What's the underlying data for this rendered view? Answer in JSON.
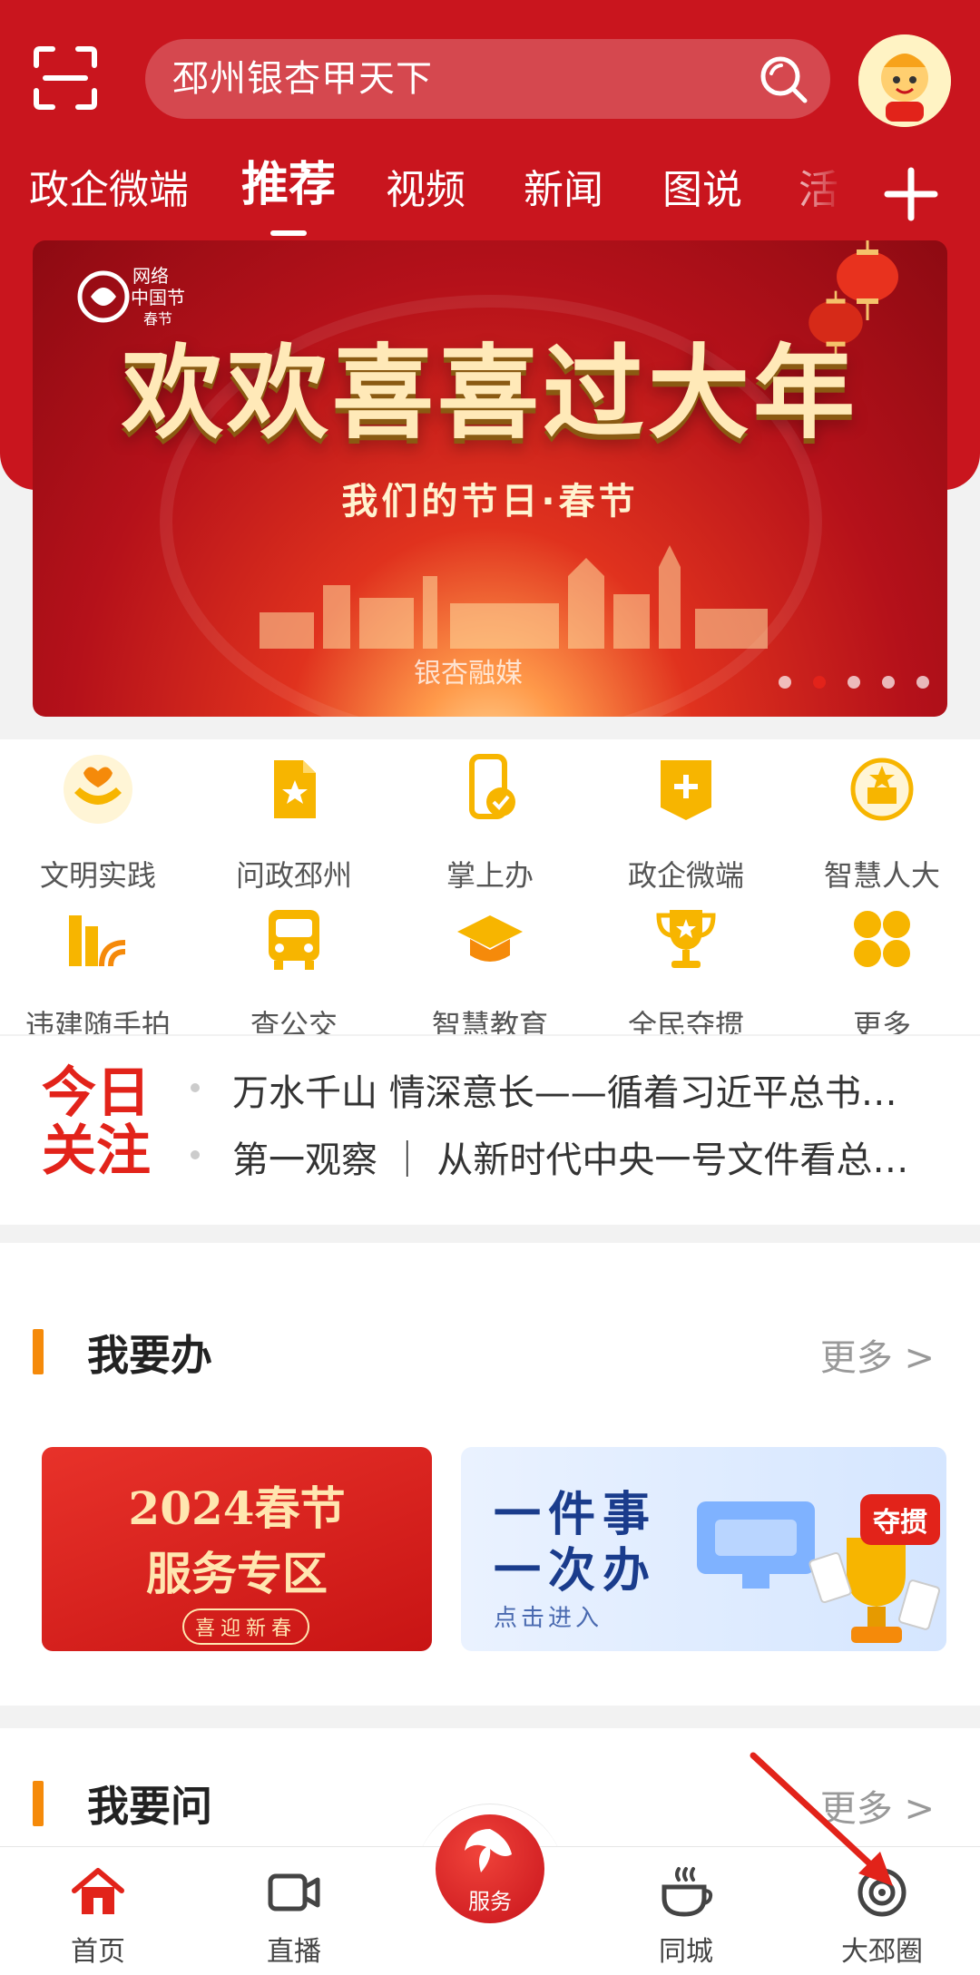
{
  "header": {
    "search_placeholder": "邳州银杏甲天下",
    "tabs": [
      "政企微端",
      "推荐",
      "视频",
      "新闻",
      "图说",
      "活"
    ],
    "active_tab_index": 1
  },
  "banner": {
    "logo_text": "网络中国节",
    "title": "欢欢喜喜过大年",
    "subtitle": "我们的节日·春节",
    "brand": "银杏融媒",
    "slide_count": 5,
    "active_slide": 1
  },
  "services": [
    {
      "label": "文明实践",
      "icon": "hands-heart-icon"
    },
    {
      "label": "问政邳州",
      "icon": "star-document-icon"
    },
    {
      "label": "掌上办",
      "icon": "phone-check-icon"
    },
    {
      "label": "政企微端",
      "icon": "plus-badge-icon"
    },
    {
      "label": "智慧人大",
      "icon": "emblem-icon"
    },
    {
      "label": "违建随手拍",
      "icon": "building-camera-icon"
    },
    {
      "label": "查公交",
      "icon": "bus-icon"
    },
    {
      "label": "智慧教育",
      "icon": "graduation-cap-icon"
    },
    {
      "label": "全民夺掼",
      "icon": "trophy-icon"
    },
    {
      "label": "更多",
      "icon": "grid-more-icon"
    }
  ],
  "focus": {
    "logo_line1": "今日",
    "logo_line2": "关注",
    "items": [
      "万水千山 情深意长——循着习近平总书…",
      "第一观察 ｜ 从新时代中央一号文件看总…"
    ]
  },
  "section_todo": {
    "title": "我要办",
    "more": "更多 >",
    "card1": {
      "year": "2024春节",
      "title": "服务专区",
      "tag": "喜迎新春"
    },
    "card2": {
      "line1": "一件事",
      "line2": "一次办",
      "hint": "点击进入",
      "badge": "夺掼"
    }
  },
  "section_ask": {
    "title": "我要问",
    "more": "更多 >"
  },
  "bottom_nav": {
    "items": [
      "首页",
      "直播",
      "服务",
      "同城",
      "大邳圈"
    ],
    "active_color": "#e2231a"
  },
  "colors": {
    "brand_red": "#c9151e",
    "accent_orange": "#f58a0a",
    "icon_yellow": "#f7b500"
  }
}
